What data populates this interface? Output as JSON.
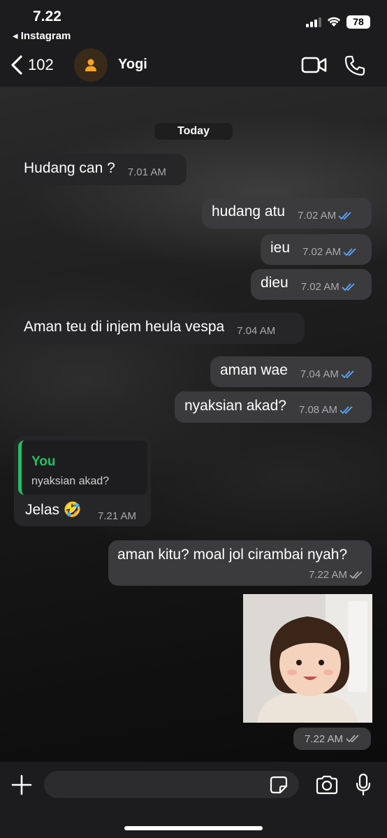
{
  "status_bar": {
    "time": "7.22",
    "back_app": "◂ Instagram",
    "battery": "78"
  },
  "header": {
    "back_count": "102",
    "contact_name": "Yogi"
  },
  "chat": {
    "date_label": "Today",
    "messages": [
      {
        "text": "Hudang can ?",
        "time": "7.01 AM",
        "direction": "in"
      },
      {
        "text": "hudang atu",
        "time": "7.02 AM",
        "direction": "out",
        "status": "read"
      },
      {
        "text": "ieu",
        "time": "7.02 AM",
        "direction": "out",
        "status": "read"
      },
      {
        "text": "dieu",
        "time": "7.02 AM",
        "direction": "out",
        "status": "read"
      },
      {
        "text": "Aman teu di injem heula vespa",
        "time": "7.04 AM",
        "direction": "in"
      },
      {
        "text": "aman wae",
        "time": "7.04 AM",
        "direction": "out",
        "status": "read"
      },
      {
        "text": "nyaksian akad?",
        "time": "7.08 AM",
        "direction": "out",
        "status": "read"
      },
      {
        "reply_to_name": "You",
        "reply_to_text": "nyaksian akad?",
        "text": "Jelas 🤣",
        "time": "7.21 AM",
        "direction": "in"
      },
      {
        "text": "aman kitu? moal jol cirambai nyah?",
        "time": "7.22 AM",
        "direction": "out",
        "status": "delivered"
      },
      {
        "type": "sticker",
        "time": "7.22 AM",
        "direction": "out",
        "status": "delivered"
      }
    ]
  },
  "composer": {
    "placeholder": ""
  },
  "colors": {
    "read_check": "#5aa7ff",
    "delivered_check": "#a9a9ae",
    "quote_accent": "#21c063",
    "outgoing_bubble": "#3b3b3d",
    "incoming_bubble": "#262628"
  },
  "icons": [
    "back-chevron-icon",
    "person-icon",
    "video-icon",
    "phone-icon",
    "plus-icon",
    "sticker-icon",
    "camera-icon",
    "mic-icon",
    "double-check-icon"
  ]
}
